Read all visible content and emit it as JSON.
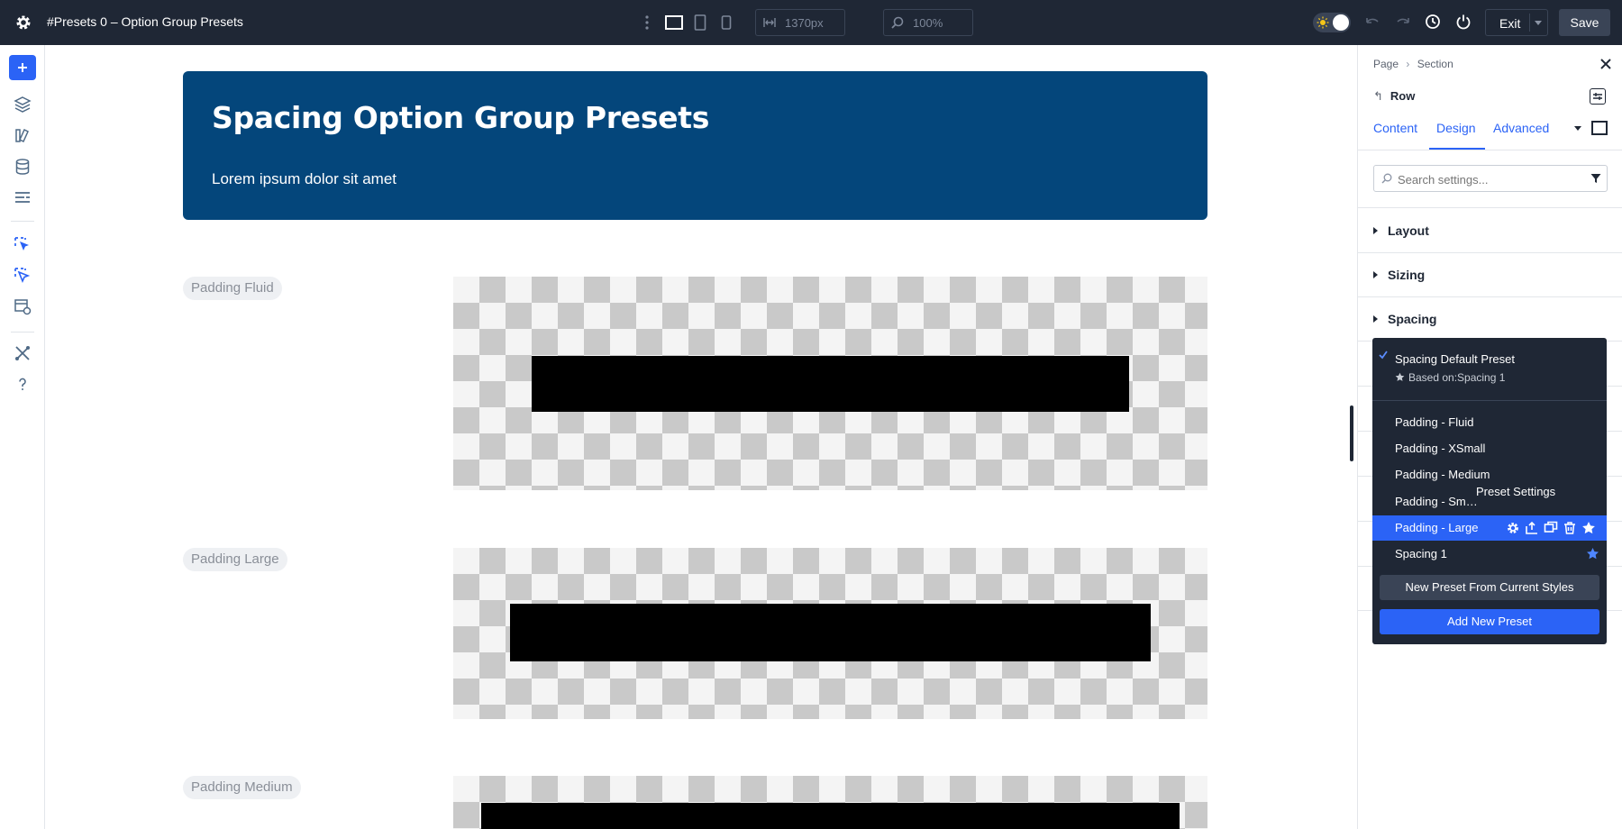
{
  "topbar": {
    "title": "#Presets 0 – Option Group Presets",
    "width_value": "1370px",
    "zoom_value": "100%",
    "exit_label": "Exit",
    "save_label": "Save"
  },
  "canvas": {
    "hero_title": "Spacing Option Group Presets",
    "hero_text": "Lorem ipsum dolor sit amet",
    "sections": [
      {
        "label": "Padding Fluid"
      },
      {
        "label": "Padding Large"
      },
      {
        "label": "Padding Medium"
      }
    ]
  },
  "panel": {
    "breadcrumb": [
      "Page",
      "Section"
    ],
    "element_title": "Row",
    "tabs": [
      {
        "label": "Content",
        "active": false
      },
      {
        "label": "Design",
        "active": true
      },
      {
        "label": "Advanced",
        "active": false
      }
    ],
    "search_placeholder": "Search settings...",
    "groups": [
      "Layout",
      "Sizing",
      "Spacing"
    ]
  },
  "preset_menu": {
    "default_preset": "Spacing Default Preset",
    "based_on": "Based on:Spacing 1",
    "items": [
      {
        "label": "Padding - Fluid",
        "selected": false
      },
      {
        "label": "Padding - XSmall",
        "selected": false
      },
      {
        "label": "Padding - Medium",
        "selected": false
      },
      {
        "label": "Padding - Sm…",
        "selected": false
      },
      {
        "label": "Padding - Large",
        "selected": true
      },
      {
        "label": "Spacing 1",
        "selected": false,
        "starred": true
      }
    ],
    "tooltip": "Preset Settings",
    "new_from_current_label": "New Preset From Current Styles",
    "add_new_label": "Add New Preset"
  },
  "colors": {
    "topbar_bg": "#1f2735",
    "accent": "#2b63f6",
    "hero_bg": "#04467b"
  },
  "icons": [
    "settings-gear-icon",
    "more-vertical-icon",
    "desktop-view-icon",
    "tablet-view-icon",
    "phone-view-icon",
    "width-icon",
    "zoom-icon",
    "sun-icon",
    "undo-icon",
    "redo-icon",
    "history-icon",
    "power-icon",
    "plus-icon",
    "layers-icon",
    "theme-icon",
    "database-icon",
    "list-icon",
    "preset-icon",
    "preset-alt-icon",
    "template-icon",
    "tools-icon",
    "help-icon",
    "close-icon",
    "options-icon",
    "search-icon",
    "filter-icon",
    "check-icon",
    "star-icon",
    "gear-icon",
    "export-icon",
    "duplicate-icon",
    "trash-icon"
  ]
}
